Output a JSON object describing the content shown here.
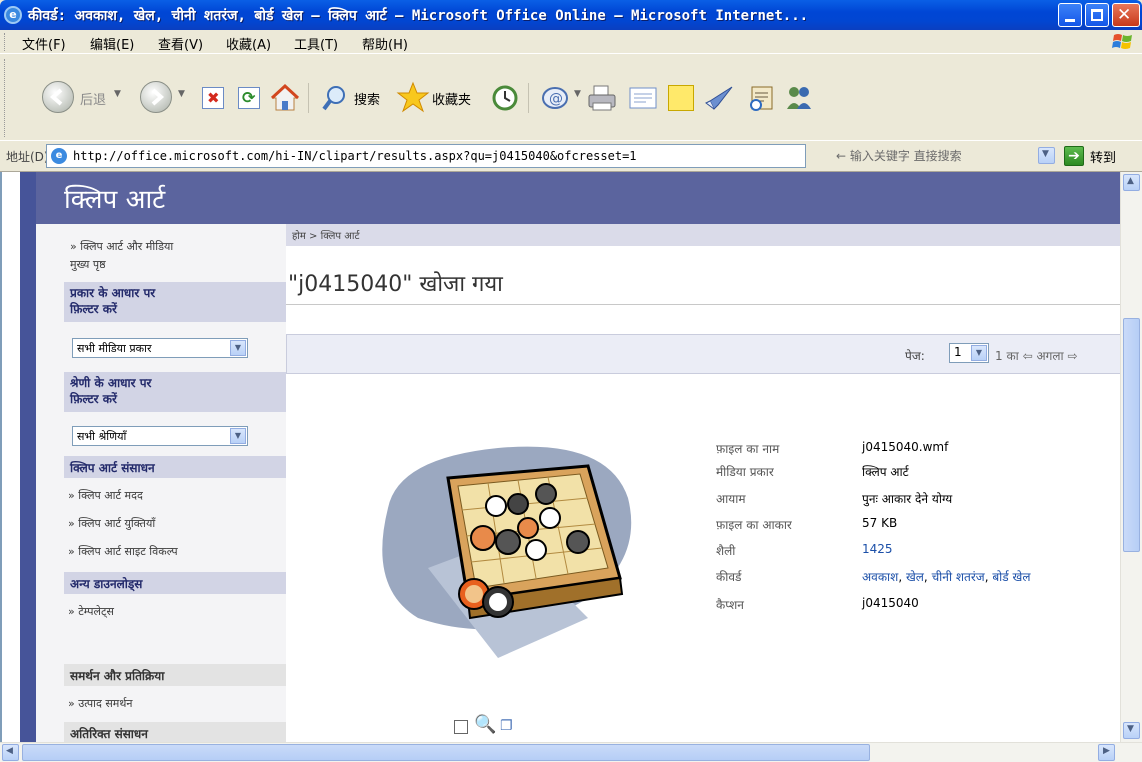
{
  "window": {
    "title": "कीवर्ड: अवकाश, खेल, चीनी शतरंज, बोर्ड खेल – क्लिप आर्ट – Microsoft Office Online – Microsoft Internet..."
  },
  "menu": {
    "items": [
      "文件(F)",
      "编辑(E)",
      "查看(V)",
      "收藏(A)",
      "工具(T)",
      "帮助(H)"
    ]
  },
  "toolbar": {
    "back_label": "后退",
    "search_label": "搜索",
    "favorites_label": "收藏夹"
  },
  "address": {
    "label": "地址(D)",
    "url": "http://office.microsoft.com/hi-IN/clipart/results.aspx?qu=j0415040&ofcresset=1",
    "search_hint": "← 输入关键字 直接搜索",
    "go_label": "转到"
  },
  "page": {
    "header_title": "क्लिप आर्ट",
    "breadcrumb": "होम > क्लिप आर्ट",
    "result_title": "\"j0415040\" खोजा गया",
    "pager": {
      "label": "पेज:",
      "current": "1",
      "suffix": "1 का ⇦ अगला ⇨"
    }
  },
  "sidebar": {
    "home_link": "» क्लिप आर्ट और मीडिया\nमुख्य पृष्ठ",
    "filter_type_heading": "प्रकार के आधार पर\nफ़िल्टर करें",
    "filter_type_value": "सभी मीडिया प्रकार",
    "filter_category_heading": "श्रेणी के आधार पर\nफ़िल्टर करें",
    "filter_category_value": "सभी श्रेणियाँ",
    "resources_heading": "क्लिप आर्ट संसाधन",
    "resource_links": [
      "» क्लिप आर्ट मदद",
      "» क्लिप आर्ट युक्तियाँ",
      "» क्लिप आर्ट साइट विकल्प"
    ],
    "downloads_heading": "अन्य डाउनलोड्स",
    "downloads_link": "» टेम्पलेट्स",
    "support_heading": "समर्थन और प्रतिक्रिया",
    "support_link": "» उत्पाद समर्थन",
    "extra_heading": "अतिरिक्त संसाधन"
  },
  "details": {
    "labels": [
      "फ़ाइल का नाम",
      "मीडिया प्रकार",
      "आयाम",
      "फ़ाइल का आकार",
      "शैली",
      "कीवर्ड",
      "कैप्शन"
    ],
    "file_name": "j0415040.wmf",
    "media_type": "क्लिप आर्ट",
    "dimensions": "पुनः आकार देने योग्य",
    "file_size": "57 KB",
    "style": "1425",
    "keywords": [
      "अवकाश",
      "खेल",
      "चीनी शतरंज",
      "बोर्ड खेल"
    ],
    "caption": "j0415040"
  }
}
